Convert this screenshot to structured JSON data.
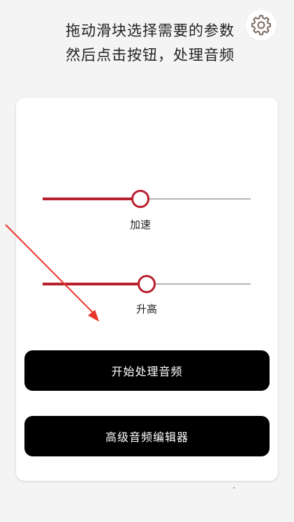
{
  "header": {
    "instruction_line1": "拖动滑块选择需要的参数",
    "instruction_line2": "然后点击按钮，处理音频",
    "settings_icon": "gear-icon"
  },
  "sliders": [
    {
      "label": "加速",
      "value_fraction": 0.47
    },
    {
      "label": "升高",
      "value_fraction": 0.5
    }
  ],
  "buttons": {
    "process_label": "开始处理音频",
    "editor_label": "高级音频编辑器"
  },
  "colors": {
    "accent": "#b8202e",
    "track": "#b4b4b4",
    "button_bg": "#000000",
    "annotation_arrow": "#e8352a"
  }
}
